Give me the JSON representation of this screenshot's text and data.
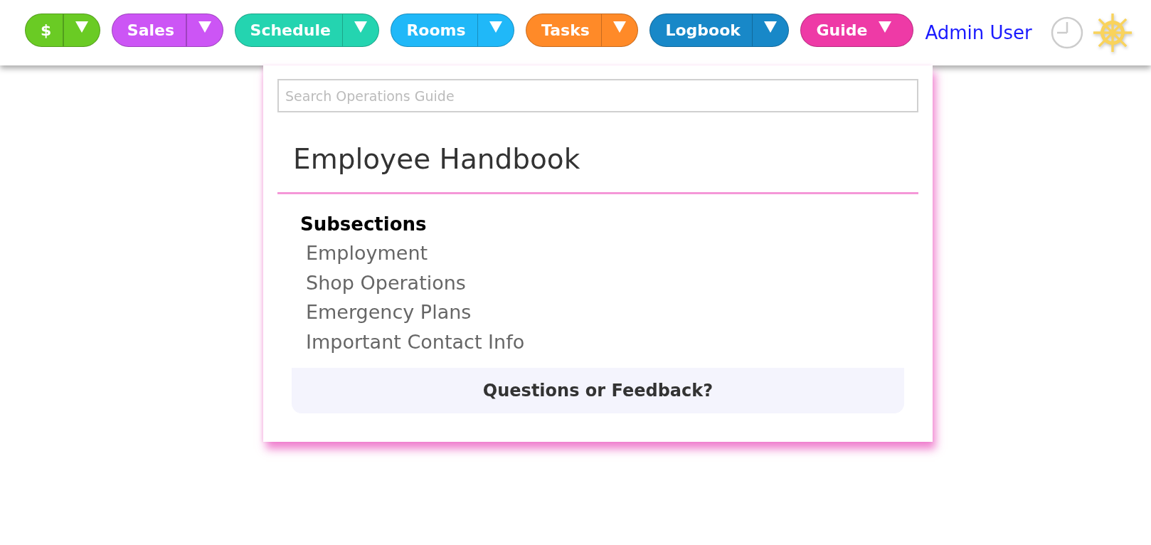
{
  "menus": [
    {
      "label": "$",
      "color": "#6acb24",
      "expanded": false
    },
    {
      "label": "Sales",
      "color": "#cc55f5",
      "expanded": false
    },
    {
      "label": "Schedule",
      "color": "#24d4b0",
      "expanded": false
    },
    {
      "label": "Rooms",
      "color": "#20b8f8",
      "expanded": false
    },
    {
      "label": "Tasks",
      "color": "#ff8a28",
      "expanded": false
    },
    {
      "label": "Logbook",
      "color": "#1888c8",
      "expanded": false
    },
    {
      "label": "Guide",
      "color": "#ee3aa6",
      "expanded": true
    }
  ],
  "user": {
    "name": "Admin User"
  },
  "guide_panel": {
    "search": {
      "placeholder": "Search Operations Guide"
    },
    "title": "Employee Handbook",
    "subsections_heading": "Subsections",
    "subsections": [
      "Employment",
      "Shop Operations",
      "Emergency Plans",
      "Important Contact Info"
    ],
    "feedback_button": "Questions or Feedback?"
  }
}
